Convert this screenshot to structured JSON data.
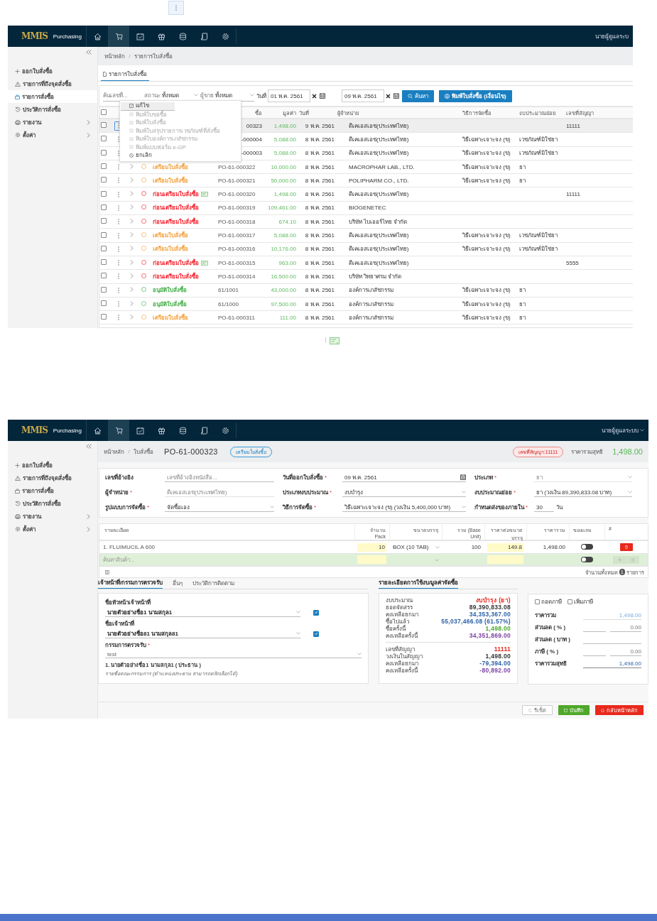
{
  "list_screen": {
    "header": {
      "logo": "MMIS",
      "app_name": "Purchasing",
      "nav": [
        {
          "selected": false
        },
        {
          "selected": true
        },
        {
          "selected": false
        },
        {
          "selected": false
        },
        {
          "selected": false
        },
        {
          "selected": false
        },
        {
          "selected": false
        }
      ],
      "user": "นายผู้ดูแลระบ"
    },
    "sidebar": {
      "items": [
        {
          "label": "ออกใบสั่งซื้อ",
          "selected": false,
          "submenu": false
        },
        {
          "label": "รายการที่ถึงจุดสั่งซื้อ",
          "selected": false,
          "submenu": false
        },
        {
          "label": "รายการสั่งซื้อ",
          "selected": true,
          "submenu": false
        },
        {
          "label": "ประวัติการสั่งซื้อ",
          "selected": false,
          "submenu": false
        },
        {
          "label": "รายงาน",
          "selected": false,
          "submenu": true
        },
        {
          "label": "ตั้งค่า",
          "selected": false,
          "submenu": true
        }
      ]
    },
    "breadcrumb": [
      "หน้าหลัก",
      "รายการใบสั่งซื้อ"
    ],
    "tabs": [
      {
        "label": "รายการใบสั่งซื้อ",
        "selected": true
      }
    ],
    "filters": {
      "search": {
        "placeholder": "ค้นเลขที่..."
      },
      "status": {
        "label": "สถานะ",
        "value": "ทั้งหมด"
      },
      "vendor": {
        "label": "ผู้ขาย",
        "value": "ทั้งหมด"
      },
      "date_label": "วันที่",
      "date_from": "01 พ.ค. 2561",
      "date_to": "09 พ.ค. 2561",
      "search_button": "ค้นหา",
      "print_button": "พิมพ์ใบสั่งซื้อ (เงื่อนไข)"
    },
    "table": {
      "header_checked": false,
      "columns": [
        "ซื้อ",
        "มูลค่า",
        "วันที่",
        "ผู้จำหน่าย",
        "วิธีการจัดซื้อ",
        "งบประมาณย่อย",
        "เลขที่สัญญา"
      ],
      "rows": [
        {
          "selected": true,
          "checked": false,
          "po": "00323",
          "value": "1,498.00",
          "date": "9 พ.ค. 2561",
          "vendor": "ดีเคเอสเอช(ประเทศไทย)",
          "contract": "11111"
        },
        {
          "selected": false,
          "checked": false,
          "po": "-000004",
          "value": "5,088.00",
          "date": "8 พ.ค. 2561",
          "vendor": "ดีเคเอสเอช(ประเทศไทย)",
          "method": "วิธีเฉพาะเจาะจง (ข)",
          "budget": "เวชภัณฑ์มิใช่ยา"
        },
        {
          "selected": false,
          "checked": false,
          "po": "-000003",
          "value": "5,088.00",
          "date": "8 พ.ค. 2561",
          "vendor": "ดีเคเอสเอช(ประเทศไทย)",
          "method": "วิธีเฉพาะเจาะจง (ข)",
          "budget": "เวชภัณฑ์มิใช่ยา"
        },
        {
          "selected": false,
          "checked": false,
          "status": "เตรียมใบสั่งซื้อ",
          "kind": "prepare",
          "note": false,
          "po": "PO-61-000322",
          "value": "10,000.00",
          "date": "8 พ.ค. 2561",
          "vendor": "MACROPHAR LAB., LTD.",
          "method": "วิธีเฉพาะเจาะจง (ข)",
          "budget": "ยา"
        },
        {
          "selected": false,
          "checked": false,
          "status": "เตรียมใบสั่งซื้อ",
          "kind": "prepare",
          "note": false,
          "po": "PO-61-000321",
          "value": "50,000.00",
          "date": "8 พ.ค. 2561",
          "vendor": "POLIPHARM CO., LTD.",
          "method": "วิธีเฉพาะเจาะจง (ข)",
          "budget": "ยา"
        },
        {
          "selected": false,
          "checked": false,
          "status": "ก่อนเตรียมใบสั่งซื้อ",
          "kind": "draft",
          "note": true,
          "po": "PO-61-000320",
          "value": "1,498.00",
          "date": "8 พ.ค. 2561",
          "vendor": "ดีเคเอสเอช(ประเทศไทย)",
          "contract": "11111"
        },
        {
          "selected": false,
          "checked": false,
          "status": "ก่อนเตรียมใบสั่งซื้อ",
          "kind": "draft",
          "note": false,
          "po": "PO-61-000319",
          "value": "109,461.00",
          "date": "8 พ.ค. 2561",
          "vendor": "BIOGENETEC"
        },
        {
          "selected": false,
          "checked": false,
          "status": "ก่อนเตรียมใบสั่งซื้อ",
          "kind": "draft",
          "note": false,
          "po": "PO-61-000318",
          "value": "674.10",
          "date": "8 พ.ค. 2561",
          "vendor": "บริษัท ไบเออร์ไทย จำกัด"
        },
        {
          "selected": false,
          "checked": false,
          "status": "เตรียมใบสั่งซื้อ",
          "kind": "prepare",
          "note": false,
          "po": "PO-61-000317",
          "value": "5,088.00",
          "date": "8 พ.ค. 2561",
          "vendor": "ดีเคเอสเอช(ประเทศไทย)",
          "method": "วิธีเฉพาะเจาะจง (ข)",
          "budget": "เวชภัณฑ์มิใช่ยา"
        },
        {
          "selected": false,
          "checked": false,
          "status": "เตรียมใบสั่งซื้อ",
          "kind": "prepare",
          "note": false,
          "po": "PO-61-000316",
          "value": "10,176.00",
          "date": "8 พ.ค. 2561",
          "vendor": "ดีเคเอสเอช(ประเทศไทย)",
          "method": "วิธีเฉพาะเจาะจง (ข)",
          "budget": "เวชภัณฑ์มิใช่ยา"
        },
        {
          "selected": false,
          "checked": false,
          "status": "ก่อนเตรียมใบสั่งซื้อ",
          "kind": "draft",
          "note": true,
          "po": "PO-61-000315",
          "value": "963.00",
          "date": "8 พ.ค. 2561",
          "vendor": "ดีเคเอสเอช(ประเทศไทย)",
          "contract": "5555"
        },
        {
          "selected": false,
          "checked": false,
          "status": "ก่อนเตรียมใบสั่งซื้อ",
          "kind": "draft",
          "note": false,
          "po": "PO-61-000314",
          "value": "16,500.00",
          "date": "8 พ.ค. 2561",
          "vendor": "บริษัท วิทยาศรม จำกัด"
        },
        {
          "selected": false,
          "checked": false,
          "status": "อนุมัติใบสั่งซื้อ",
          "kind": "approved",
          "note": false,
          "po": "61/1001",
          "value": "43,000.00",
          "date": "8 พ.ค. 2561",
          "vendor": "องค์การเภสัชกรรม",
          "method": "วิธีเฉพาะเจาะจง (ข)",
          "budget": "ยา"
        },
        {
          "selected": false,
          "checked": false,
          "status": "อนุมัติใบสั่งซื้อ",
          "kind": "approved",
          "note": false,
          "po": "61/1000",
          "value": "97,500.00",
          "date": "8 พ.ค. 2561",
          "vendor": "องค์การเภสัชกรรม",
          "method": "วิธีเฉพาะเจาะจง (ข)",
          "budget": "ยา"
        },
        {
          "selected": false,
          "checked": false,
          "status": "เตรียมใบสั่งซื้อ",
          "kind": "prepare",
          "note": false,
          "po": "PO-61-000311",
          "value": "111.00",
          "date": "8 พ.ค. 2561",
          "vendor": "องค์การเภสัชกรรม",
          "method": "วิธีเฉพาะเจาะจง (ข)",
          "budget": "ยา"
        }
      ]
    },
    "row_menu": {
      "items": [
        {
          "label": "แก้ไข",
          "disabled": false,
          "selected": true
        },
        {
          "label": "พิมพ์ใบขอซื้อ",
          "disabled": true,
          "selected": false
        },
        {
          "label": "พิมพ์ใบสั่งซื้อ",
          "disabled": true,
          "selected": false
        },
        {
          "label": "พิมพ์ใบสรุปรายการเวชภัณฑ์ที่สั่งซื้อ",
          "disabled": true,
          "selected": false
        },
        {
          "label": "พิมพ์ใบองค์การเภสัชกรรม",
          "disabled": true,
          "selected": false
        },
        {
          "label": "พิมพ์แบบฟอร์ม e-GP",
          "disabled": true,
          "selected": false
        },
        {
          "label": "ยกเลิก",
          "disabled": false,
          "selected": false
        }
      ]
    }
  },
  "detail_screen": {
    "header": {
      "logo": "MMIS",
      "app_name": "Purchasing",
      "nav": [
        {
          "selected": false
        },
        {
          "selected": true
        },
        {
          "selected": false
        },
        {
          "selected": false
        },
        {
          "selected": false
        },
        {
          "selected": false
        },
        {
          "selected": false
        }
      ],
      "user": "นายผู้ดูแลระบบ"
    },
    "sidebar": {
      "items": [
        {
          "label": "ออกใบสั่งซื้อ",
          "selected": false,
          "submenu": false
        },
        {
          "label": "รายการที่ถึงจุดสั่งซื้อ",
          "selected": false,
          "submenu": false
        },
        {
          "label": "รายการสั่งซื้อ",
          "selected": false,
          "submenu": false
        },
        {
          "label": "ประวัติการสั่งซื้อ",
          "selected": false,
          "submenu": false
        },
        {
          "label": "รายงาน",
          "selected": false,
          "submenu": true
        },
        {
          "label": "ตั้งค่า",
          "selected": false,
          "submenu": true
        }
      ]
    },
    "breadcrumb": [
      "หน้าหลัก",
      "ใบสั่งซื้อ"
    ],
    "title": "PO-61-000323",
    "status_badge": "เตรียมใบสั่งซื้อ",
    "contract_badge": "เลขที่สัญญา:11111",
    "net_label": "ราคารวมสุทธิ",
    "net_total": "1,498.00",
    "form": {
      "fields": [
        {
          "label": "เลขที่อ้างอิง",
          "kind": "text",
          "placeholder": "เลขที่อ้างอิงหนังสือ...",
          "disabled": false
        },
        {
          "label": "วันที่ออกใบสั่งซื้อ",
          "required_mark": "*",
          "kind": "date",
          "value": "09 พ.ค. 2561",
          "disabled": false
        },
        {
          "label": "ประเภท",
          "required_mark": "*",
          "kind": "select",
          "value": "ยา",
          "disabled": true
        },
        {
          "label": "ผู้จำหน่าย",
          "required_mark": "*",
          "kind": "text",
          "value": "ดีเคเอสเอช(ประเทศไทย)",
          "disabled": true
        },
        {
          "label": "ประเภทงบประมาณ",
          "required_mark": "*",
          "kind": "select",
          "value": "งบบำรุง",
          "disabled": false
        },
        {
          "label": "งบประมาณย่อย",
          "required_mark": "*",
          "kind": "select",
          "value": "ยา (วงเงิน 89,390,833.08 บาท)",
          "disabled": false
        },
        {
          "label": "รูปแบบการจัดซื้อ",
          "required_mark": "*",
          "kind": "select",
          "value": "จัดซื้อเอง",
          "disabled": false
        },
        {
          "label": "วิธีการจัดซื้อ",
          "required_mark": "*",
          "kind": "select",
          "value": "วิธีเฉพาะเจาะจง (ข) (วงเงิน 5,400,000 บาท)",
          "disabled": false
        },
        {
          "label": "กำหนดส่งของภายใน",
          "required_mark": "*",
          "kind": "number",
          "value": "30",
          "suffix": "วัน",
          "disabled": false
        }
      ]
    },
    "items": {
      "columns": [
        "รายละเอียด",
        "จำนวน Pack",
        "ขนาดบรรจุ",
        "รวม (Base Unit)",
        "ราคาต่อขนาดบรรจุ",
        "ราคารวม",
        "ของแถม",
        "#"
      ],
      "rows": [
        {
          "name": "1. FLUIMUCIL A 600",
          "qty": "10",
          "unit": "BOX (10 TAB)",
          "base_qty": "100",
          "price": "149.8",
          "total": "1,498.00",
          "free": false
        }
      ],
      "new_row": {
        "placeholder": "ค้นหาสินค้า...",
        "free": false
      },
      "count_label": "จำนวนทั้งหมด",
      "count": "1",
      "count_unit": "รายการ"
    },
    "tabs": [
      {
        "label": "เจ้าหน้าที่/กรรมการตรวจรับ",
        "selected": true
      },
      {
        "label": "อื่นๆ",
        "selected": false
      },
      {
        "label": "ประวัติการติดตาม",
        "selected": false
      }
    ],
    "side_tabs": [
      {
        "label": "รายละเอียดการใช้งบ/มูลค่าจัดซื้อ",
        "selected": true
      }
    ],
    "staff": {
      "fields": [
        {
          "label": "ชื่อหัวหน้าเจ้าหน้าที่",
          "value": "นายตัวอย่างชื่อ1 นามสกุล1",
          "checked": true
        },
        {
          "label": "ชื่อเจ้าหน้าที่",
          "value": "นายตัวอย่างชื่อ81 นามสกุล81",
          "checked": true
        }
      ],
      "committee": {
        "label": "กรรมการตรวจรับ",
        "required_mark": "*",
        "value": "test"
      },
      "members": [
        "1. นายตัวอย่างชื่อ1 นามสกุล1 ( ประธาน )"
      ],
      "note": "รายชื่อคณะกรรมการ (ตำแหน่งประธาน สามารถคลิกเลือกได้)"
    },
    "budget": {
      "groups": [
        {
          "rows": [
            {
              "label": "งบประมาณ",
              "value": "งบบำรุง (ยา)",
              "color": "#e8291c"
            },
            {
              "label": "ยอดจัดสรร",
              "value": "89,390,833.08",
              "color": "#333333"
            },
            {
              "label": "คงเหลือยกมา",
              "value": "34,353,367.00",
              "color": "#2a5fa8"
            },
            {
              "label": "ซื้อไปแล้ว",
              "value": "55,037,466.08 (61.57%)",
              "color": "#2a5fa8"
            },
            {
              "label": "ซื้อครั้งนี้",
              "value": "1,498.00",
              "color": "#4aa82a"
            },
            {
              "label": "คงเหลือครั้งนี้",
              "value": "34,351,869.00",
              "color": "#7a3fa0"
            }
          ]
        },
        {
          "rows": [
            {
              "label": "เลขที่สัญญา",
              "value": "11111",
              "color": "#e8291c"
            },
            {
              "label": "วงเงินในสัญญา",
              "value": "1,498.00",
              "color": "#333333"
            },
            {
              "label": "คงเหลือยกมา",
              "value": "-79,394.00",
              "color": "#2a5fa8"
            },
            {
              "label": "คงเหลือครั้งนี้",
              "value": "-80,892.00",
              "color": "#7a3fa0"
            }
          ]
        }
      ]
    },
    "price": {
      "options": [
        {
          "label": "ถอดภาษี",
          "checked": false
        },
        {
          "label": "เพิ่มภาษี",
          "checked": false
        }
      ],
      "rows": [
        {
          "label": "ราคารวม",
          "kind": "total",
          "value": "1,498.00"
        },
        {
          "label": "ส่วนลด ( % )",
          "kind": "percent",
          "value": "0.00"
        },
        {
          "label": "ส่วนลด ( บาท )",
          "kind": "amount"
        },
        {
          "label": "ภาษี ( % )",
          "kind": "percent",
          "value": "0.00"
        },
        {
          "label": "ราคารวมสุทธิ",
          "kind": "net",
          "value": "1,498.00"
        }
      ]
    },
    "buttons": [
      {
        "label": "รีเซ็ต",
        "kind": "reset",
        "disabled": true
      },
      {
        "label": "บันทึก",
        "kind": "save",
        "disabled": false
      },
      {
        "label": "กลับหน้าหลัก",
        "kind": "back",
        "disabled": false
      }
    ]
  }
}
